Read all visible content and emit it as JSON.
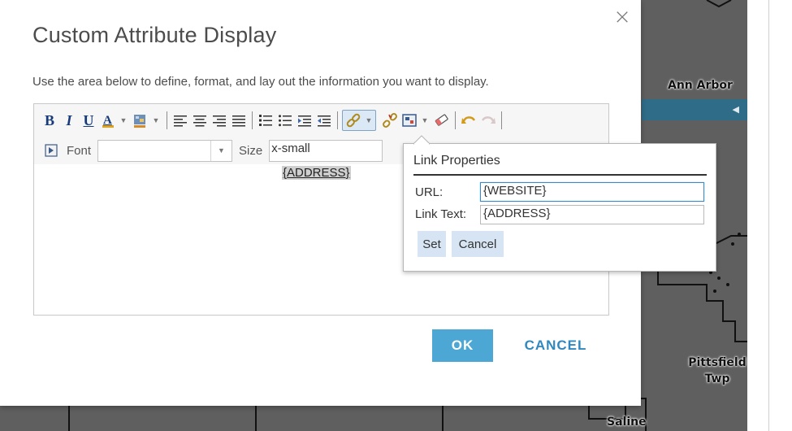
{
  "map": {
    "labels": {
      "ann_arbor": "Ann Arbor",
      "pittsfield_line1": "Pittsfield",
      "pittsfield_line2": "Twp",
      "saline": "Saline"
    }
  },
  "dialog": {
    "close_glyph": "×",
    "title": "Custom Attribute Display",
    "description": "Use the area below to define, format, and lay out the information you want to display."
  },
  "editor": {
    "toolbar": {
      "bold_label": "B",
      "italic_label": "I",
      "underline_label": "U",
      "font_label": "Font",
      "font_value": "",
      "size_label": "Size",
      "size_value": "x-small",
      "dropdown_glyph": "▼"
    },
    "content": {
      "link_text": "{ADDRESS}"
    }
  },
  "link_properties": {
    "title": "Link Properties",
    "url_label": "URL:",
    "url_value": "{WEBSITE}",
    "link_text_label": "Link Text:",
    "link_text_value": "{ADDRESS}",
    "set_label": "Set",
    "cancel_label": "Cancel"
  },
  "buttons": {
    "ok_label": "OK",
    "cancel_label": "CANCEL"
  },
  "colors": {
    "ok_button": "#4da7d5",
    "cancel_text": "#2f88bf",
    "map_background": "#5f5f5f",
    "map_bar": "#2f6c88",
    "popup_button": "#d6e4f3"
  }
}
